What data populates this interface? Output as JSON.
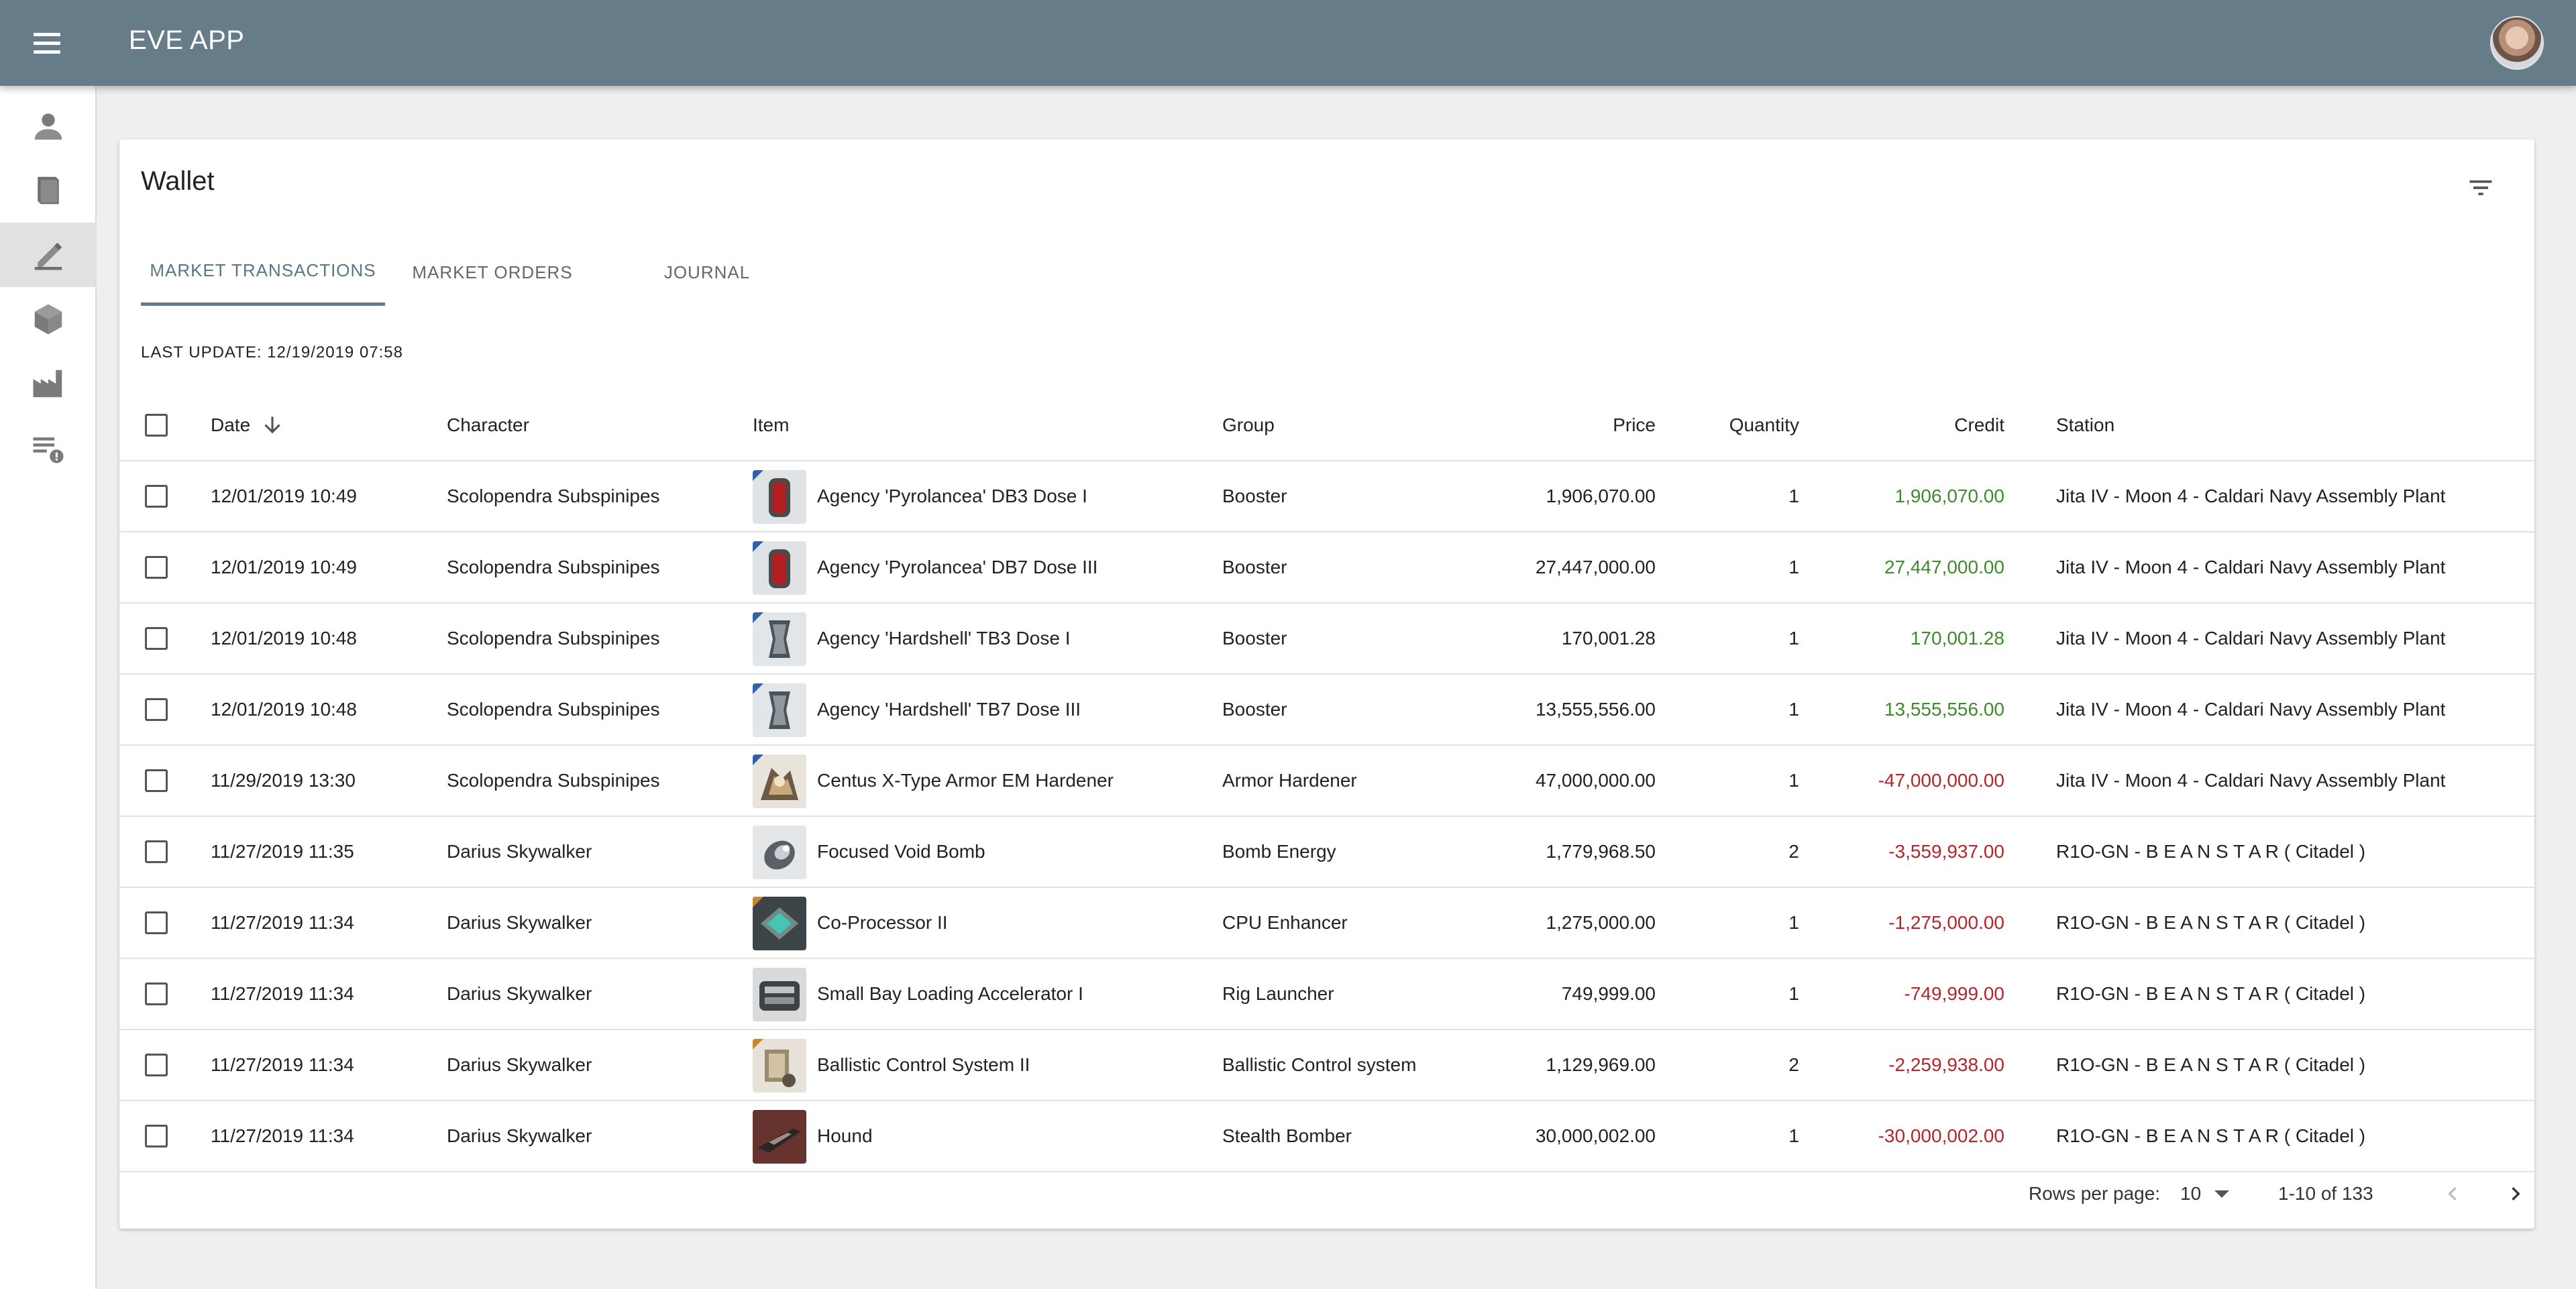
{
  "app": {
    "title": "EVE APP"
  },
  "colors": {
    "topbar": "#667c88",
    "credit_positive": "#3f8a2f",
    "credit_negative": "#b3262b",
    "tab_active": "#5f7a88"
  },
  "sidebar": {
    "items": [
      {
        "icon": "person-icon",
        "active": false
      },
      {
        "icon": "book-icon",
        "active": false
      },
      {
        "icon": "wallet-pen-icon",
        "active": true
      },
      {
        "icon": "cube-icon",
        "active": false
      },
      {
        "icon": "factory-icon",
        "active": false
      },
      {
        "icon": "list-alert-icon",
        "active": false
      }
    ]
  },
  "card": {
    "title": "Wallet",
    "filter_icon": "filter-icon",
    "tabs": [
      {
        "label": "MARKET TRANSACTIONS",
        "active": true
      },
      {
        "label": "MARKET ORDERS",
        "active": false
      },
      {
        "label": "JOURNAL",
        "active": false
      }
    ],
    "last_update": "LAST UPDATE: 12/19/2019 07:58"
  },
  "table": {
    "headers": {
      "date": "Date",
      "character": "Character",
      "item": "Item",
      "group": "Group",
      "price": "Price",
      "quantity": "Quantity",
      "credit": "Credit",
      "station": "Station"
    },
    "sort_icon": "arrow-down-icon",
    "rows": [
      {
        "date": "12/01/2019 10:49",
        "character": "Scolopendra Subspinipes",
        "item": "Agency 'Pyrolancea' DB3 Dose I",
        "item_icon": "booster-red-icon",
        "group": "Booster",
        "price": "1,906,070.00",
        "quantity": "1",
        "credit": "1,906,070.00",
        "credit_sign": "pos",
        "station": "Jita IV - Moon 4 - Caldari Navy Assembly Plant"
      },
      {
        "date": "12/01/2019 10:49",
        "character": "Scolopendra Subspinipes",
        "item": "Agency 'Pyrolancea' DB7 Dose III",
        "item_icon": "booster-red-icon",
        "group": "Booster",
        "price": "27,447,000.00",
        "quantity": "1",
        "credit": "27,447,000.00",
        "credit_sign": "pos",
        "station": "Jita IV - Moon 4 - Caldari Navy Assembly Plant"
      },
      {
        "date": "12/01/2019 10:48",
        "character": "Scolopendra Subspinipes",
        "item": "Agency 'Hardshell' TB3 Dose I",
        "item_icon": "booster-grey-icon",
        "group": "Booster",
        "price": "170,001.28",
        "quantity": "1",
        "credit": "170,001.28",
        "credit_sign": "pos",
        "station": "Jita IV - Moon 4 - Caldari Navy Assembly Plant"
      },
      {
        "date": "12/01/2019 10:48",
        "character": "Scolopendra Subspinipes",
        "item": "Agency 'Hardshell' TB7 Dose III",
        "item_icon": "booster-grey-icon",
        "group": "Booster",
        "price": "13,555,556.00",
        "quantity": "1",
        "credit": "13,555,556.00",
        "credit_sign": "pos",
        "station": "Jita IV - Moon 4 - Caldari Navy Assembly Plant"
      },
      {
        "date": "11/29/2019 13:30",
        "character": "Scolopendra Subspinipes",
        "item": "Centus X-Type Armor EM Hardener",
        "item_icon": "armor-hardener-icon",
        "group": "Armor Hardener",
        "price": "47,000,000.00",
        "quantity": "1",
        "credit": "-47,000,000.00",
        "credit_sign": "neg",
        "station": "Jita IV - Moon 4 - Caldari Navy Assembly Plant"
      },
      {
        "date": "11/27/2019 11:35",
        "character": "Darius Skywalker",
        "item": "Focused Void Bomb",
        "item_icon": "void-bomb-icon",
        "group": "Bomb Energy",
        "price": "1,779,968.50",
        "quantity": "2",
        "credit": "-3,559,937.00",
        "credit_sign": "neg",
        "station": "R1O-GN - B E A N S T A R ( Citadel )"
      },
      {
        "date": "11/27/2019 11:34",
        "character": "Darius Skywalker",
        "item": "Co-Processor II",
        "item_icon": "coprocessor-icon",
        "group": "CPU Enhancer",
        "price": "1,275,000.00",
        "quantity": "1",
        "credit": "-1,275,000.00",
        "credit_sign": "neg",
        "station": "R1O-GN - B E A N S T A R ( Citadel )"
      },
      {
        "date": "11/27/2019 11:34",
        "character": "Darius Skywalker",
        "item": "Small Bay Loading Accelerator I",
        "item_icon": "rig-icon",
        "group": "Rig Launcher",
        "price": "749,999.00",
        "quantity": "1",
        "credit": "-749,999.00",
        "credit_sign": "neg",
        "station": "R1O-GN - B E A N S T A R ( Citadel )"
      },
      {
        "date": "11/27/2019 11:34",
        "character": "Darius Skywalker",
        "item": "Ballistic Control System II",
        "item_icon": "ballistic-control-icon",
        "group": "Ballistic Control system",
        "price": "1,129,969.00",
        "quantity": "2",
        "credit": "-2,259,938.00",
        "credit_sign": "neg",
        "station": "R1O-GN - B E A N S T A R ( Citadel )"
      },
      {
        "date": "11/27/2019 11:34",
        "character": "Darius Skywalker",
        "item": "Hound",
        "item_icon": "ship-hound-icon",
        "group": "Stealth Bomber",
        "price": "30,000,002.00",
        "quantity": "1",
        "credit": "-30,000,002.00",
        "credit_sign": "neg",
        "station": "R1O-GN - B E A N S T A R ( Citadel )"
      }
    ]
  },
  "pagination": {
    "rows_per_page_label": "Rows per page:",
    "rows_per_page_value": "10",
    "range": "1-10 of 133"
  }
}
